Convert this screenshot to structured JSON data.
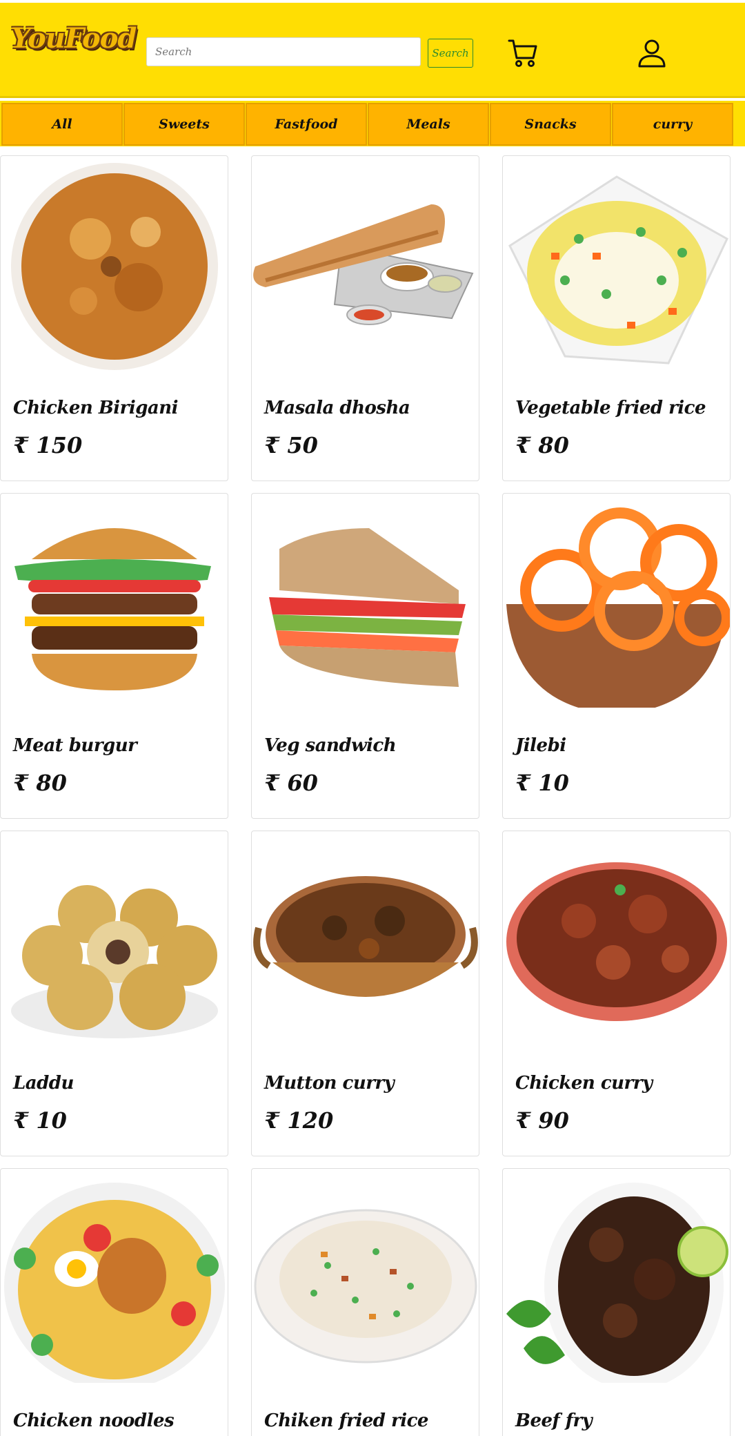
{
  "header": {
    "logo": "YouFood",
    "search_placeholder": "Search",
    "search_button": "Search",
    "cart_icon": "cart-icon",
    "user_icon": "user-icon"
  },
  "categories": [
    "All",
    "Sweets",
    "Fastfood",
    "Meals",
    "Snacks",
    "curry"
  ],
  "currency_symbol": "₹",
  "products": [
    {
      "name": "Chicken Birigani",
      "price": "₹ 150",
      "icon": "biryani-image"
    },
    {
      "name": "Masala dhosha",
      "price": "₹ 50",
      "icon": "dosa-image"
    },
    {
      "name": "Vegetable fried rice",
      "price": "₹ 80",
      "icon": "veg-fried-rice-image"
    },
    {
      "name": "Meat burgur",
      "price": "₹ 80",
      "icon": "burger-image"
    },
    {
      "name": "Veg sandwich",
      "price": "₹ 60",
      "icon": "sandwich-image"
    },
    {
      "name": "Jilebi",
      "price": "₹ 10",
      "icon": "jalebi-image"
    },
    {
      "name": "Laddu",
      "price": "₹ 10",
      "icon": "laddu-image"
    },
    {
      "name": "Mutton curry",
      "price": "₹ 120",
      "icon": "mutton-curry-image"
    },
    {
      "name": "Chicken curry",
      "price": "₹ 90",
      "icon": "chicken-curry-image"
    },
    {
      "name": "Chicken noodles",
      "price": "",
      "icon": "noodles-image"
    },
    {
      "name": "Chiken fried rice",
      "price": "",
      "icon": "chicken-fried-rice-image"
    },
    {
      "name": "Beef fry",
      "price": "",
      "icon": "beef-fry-image"
    }
  ],
  "colors": {
    "header_bg": "#ffde03",
    "tab_bg": "#ffb300",
    "search_button_accent": "#2e8b2e"
  }
}
